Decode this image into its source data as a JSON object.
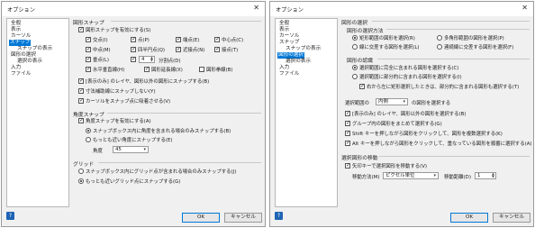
{
  "colors": {
    "selection": "#0078d7",
    "dialog_bg": "#f0f0f0",
    "help_icon": "#1e63b4"
  },
  "left": {
    "title": "オプション",
    "tree": [
      "全般",
      "表示",
      "カーソル",
      "スナップ",
      "スナップの表示",
      "図形の選択",
      "選択の表示",
      "入力",
      "ファイル"
    ],
    "sections": {
      "shape_snap": "図形スナップ",
      "angle_snap": "角度スナップ",
      "grid": "グリッド"
    },
    "enable_shape_snap": "図形スナップを有効にする(S)",
    "snaps": {
      "intersection": "交点(I)",
      "point": "点(P)",
      "endpoint": "端点(E)",
      "center": "中心点(C)",
      "midpoint": "中点(M)",
      "quadrant": "四半円点(Q)",
      "nearest": "近接点(N)",
      "tangent": "接点(T)",
      "perpendicular": "垂点(L)",
      "divide_label": "分割点(D)",
      "divide_value": "4",
      "horizontal_vertical": "水平垂直線(H)",
      "extension": "図形延長線(X)",
      "shape_boundary": "図形拳線(B)"
    },
    "options": {
      "current_layer_only": "[表示のみ] のレイヤ、図形以外の図形にスナップする(B)",
      "dimension_aux": "寸法補助線にスナップしない(Y)",
      "cursor_attract": "カーソルをスナップ点に吸着させる(V)"
    },
    "angle": {
      "enable": "角度スナップを有効にする(A)",
      "only_in_box": "スナップボックス内に角度を含まれる場合のみスナップする(B)",
      "nearest_angle": "もっとも近い角度にスナップする(E)",
      "angle_label": "角度",
      "angle_value": "45"
    },
    "grid": {
      "only_in_box": "スナップボックス内にグリッド点が含まれる場合のみスナップする(J)",
      "nearest_point": "もっとも近いグリッド点にスナップする(G)"
    },
    "ok": "OK",
    "cancel": "キャンセル",
    "help": "?"
  },
  "right": {
    "title": "オプション",
    "tree": [
      "全般",
      "表示",
      "カーソル",
      "スナップ",
      "スナップの表示",
      "図形の選択",
      "選択の表示",
      "入力",
      "ファイル"
    ],
    "sections": {
      "shape_select": "図形の選択",
      "select_method": "図形の選択方法",
      "recognition": "図形の認識",
      "move": "選択図形の移動"
    },
    "method": {
      "rect_range": "矩形範囲の図形を選択(R)",
      "polygon_range": "多角形範囲の図形を選択(P)",
      "line_cross": "線に交差する図形を選択(L)",
      "chain_cross": "連続線に交差する図形を選択(F)"
    },
    "recognition": {
      "fully_inside": "選択範囲に完全に含まれる図形を選択する(C)",
      "partially_inside": "選択範囲に部分的に含まれる図形を選択する(I)",
      "right_to_left": "右から左に矩形選択したときは、部分的に含まれる図形も選択する(T)"
    },
    "range": {
      "label": "選択範囲の",
      "value": "内側",
      "suffix": "の図形を選択する"
    },
    "options": {
      "current_layer": "[表示のみ] のレイヤ、図形以外の図形を選択する(B)",
      "group_select": "グループ内の図形をまとめて選択する(G)",
      "shift_click": "Shift キーを押しながら図形をクリックして、図形を複数選択する(K)",
      "alt_click": "Alt キーを押しながら図形をクリックして、重なっている図形を順番に選択する(A)"
    },
    "move": {
      "arrow_keys": "矢印キーで選択図形を移動する(V)",
      "method_label": "移動方法(M)",
      "method_value": "ピクセル単位",
      "distance_label": "移動距離(D)",
      "distance_value": "1"
    },
    "ok": "OK",
    "cancel": "キャンセル",
    "help": "?"
  }
}
